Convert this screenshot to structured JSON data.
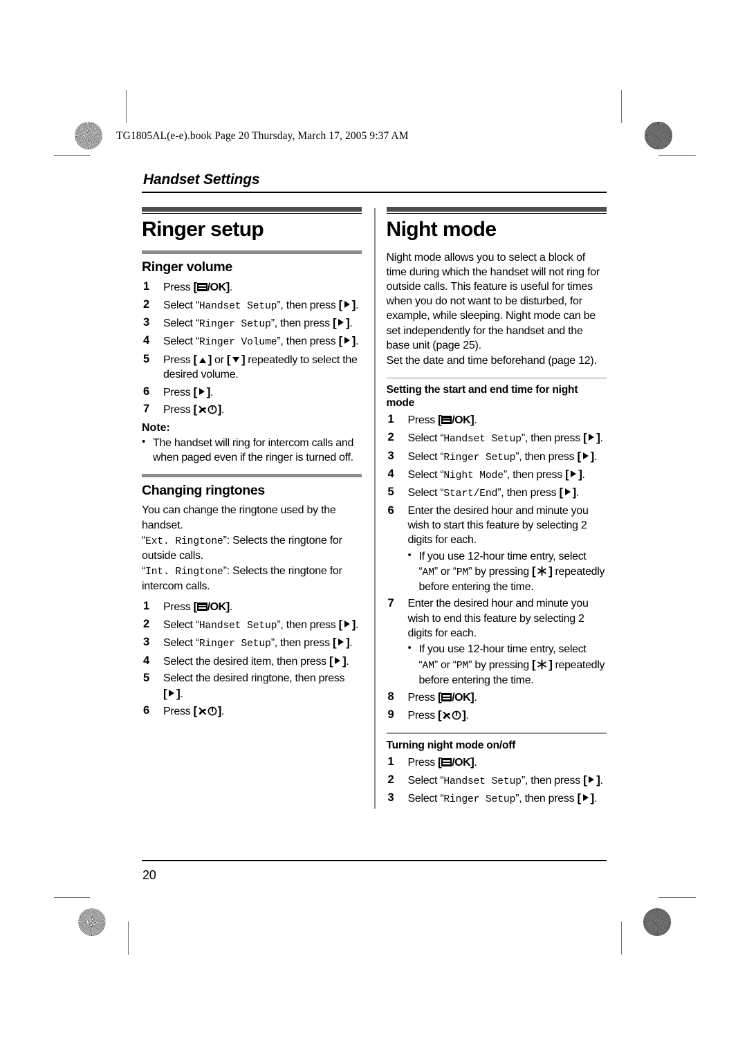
{
  "print_header": "TG1805AL(e-e).book  Page 20  Thursday, March 17, 2005  9:37 AM",
  "chapter_title": "Handset Settings",
  "page_number": "20",
  "left_column": {
    "section_title": "Ringer setup",
    "ringer_volume": {
      "heading": "Ringer volume",
      "steps": [
        {
          "num": "1",
          "pre": "Press ",
          "key": "menu-ok",
          "post": "."
        },
        {
          "num": "2",
          "pre": "Select “",
          "mono": "Handset Setup",
          "mid": "”, then press ",
          "key": "arrow-right",
          "post": "."
        },
        {
          "num": "3",
          "pre": "Select “",
          "mono": "Ringer Setup",
          "mid": "”, then press ",
          "key": "arrow-right",
          "post": "."
        },
        {
          "num": "4",
          "pre": "Select “",
          "mono": "Ringer Volume",
          "mid": "”, then press ",
          "key": "arrow-right",
          "post": "."
        },
        {
          "num": "5",
          "pre": "Press ",
          "key": "arrow-up",
          "mid": " or ",
          "key2": "arrow-down",
          "post": " repeatedly to select the desired volume."
        },
        {
          "num": "6",
          "pre": "Press ",
          "key": "arrow-right",
          "post": "."
        },
        {
          "num": "7",
          "pre": "Press ",
          "key": "off-hook",
          "post": "."
        }
      ],
      "note_label": "Note:",
      "notes": [
        "The handset will ring for intercom calls and when paged even if the ringer is turned off."
      ]
    },
    "changing_ringtones": {
      "heading": "Changing ringtones",
      "intro": "You can change the ringtone used by the handset.",
      "definitions": [
        {
          "mono": "Ext. Ringtone",
          "text": ": Selects the ringtone for outside calls."
        },
        {
          "mono": "Int. Ringtone",
          "text": ": Selects the ringtone for intercom calls."
        }
      ],
      "steps": [
        {
          "num": "1",
          "pre": "Press ",
          "key": "menu-ok",
          "post": "."
        },
        {
          "num": "2",
          "pre": "Select “",
          "mono": "Handset Setup",
          "mid": "”, then press ",
          "key": "arrow-right",
          "post": "."
        },
        {
          "num": "3",
          "pre": "Select “",
          "mono": "Ringer Setup",
          "mid": "”, then press ",
          "key": "arrow-right",
          "post": "."
        },
        {
          "num": "4",
          "pre": "Select the desired item, then press ",
          "key": "arrow-right",
          "post": "."
        },
        {
          "num": "5",
          "pre": "Select the desired ringtone, then press ",
          "key": "arrow-right",
          "post": "."
        },
        {
          "num": "6",
          "pre": "Press ",
          "key": "off-hook",
          "post": "."
        }
      ]
    }
  },
  "right_column": {
    "section_title": "Night mode",
    "intro_paragraphs": [
      "Night mode allows you to select a block of time during which the handset will not ring for outside calls. This feature is useful for times when you do not want to be disturbed, for example, while sleeping. Night mode can be set independently for the handset and the base unit (page 25).",
      "Set the date and time beforehand (page 12)."
    ],
    "start_end": {
      "heading": "Setting the start and end time for night mode",
      "steps": [
        {
          "num": "1",
          "pre": "Press ",
          "key": "menu-ok",
          "post": "."
        },
        {
          "num": "2",
          "pre": "Select “",
          "mono": "Handset Setup",
          "mid": "”, then press ",
          "key": "arrow-right",
          "post": "."
        },
        {
          "num": "3",
          "pre": "Select “",
          "mono": "Ringer Setup",
          "mid": "”, then press ",
          "key": "arrow-right",
          "post": "."
        },
        {
          "num": "4",
          "pre": "Select “",
          "mono": "Night Mode",
          "mid": "”, then press ",
          "key": "arrow-right",
          "post": "."
        },
        {
          "num": "5",
          "pre": "Select “",
          "mono": "Start/End",
          "mid": "”, then press ",
          "key": "arrow-right",
          "post": "."
        },
        {
          "num": "6",
          "pre": "Enter the desired hour and minute you wish to start this feature by selecting 2 digits for each."
        },
        {
          "num": "7",
          "pre": "Enter the desired hour and minute you wish to end this feature by selecting 2 digits for each."
        },
        {
          "num": "8",
          "pre": "Press ",
          "key": "menu-ok",
          "post": "."
        },
        {
          "num": "9",
          "pre": "Press ",
          "key": "off-hook",
          "post": "."
        }
      ],
      "am_pm_note": {
        "pre": "If you use 12-hour time entry, select “",
        "mono1": "AM",
        "mid1": "” or “",
        "mono2": "PM",
        "mid2": "” by pressing ",
        "key": "star",
        "post": " repeatedly before entering the time."
      }
    },
    "turning_on_off": {
      "heading": "Turning night mode on/off",
      "steps": [
        {
          "num": "1",
          "pre": "Press ",
          "key": "menu-ok",
          "post": "."
        },
        {
          "num": "2",
          "pre": "Select “",
          "mono": "Handset Setup",
          "mid": "”, then press ",
          "key": "arrow-right",
          "post": "."
        },
        {
          "num": "3",
          "pre": "Select “",
          "mono": "Ringer Setup",
          "mid": "”, then press ",
          "key": "arrow-right",
          "post": "."
        }
      ]
    }
  },
  "icons": {
    "menu_ok_label": "/OK",
    "bracket_open": "[",
    "bracket_close": "]"
  },
  "colors": {
    "heading_bar": "#4d4d4d",
    "subheading_bar": "#8c8c8c",
    "rule": "#000000",
    "text": "#000000"
  }
}
